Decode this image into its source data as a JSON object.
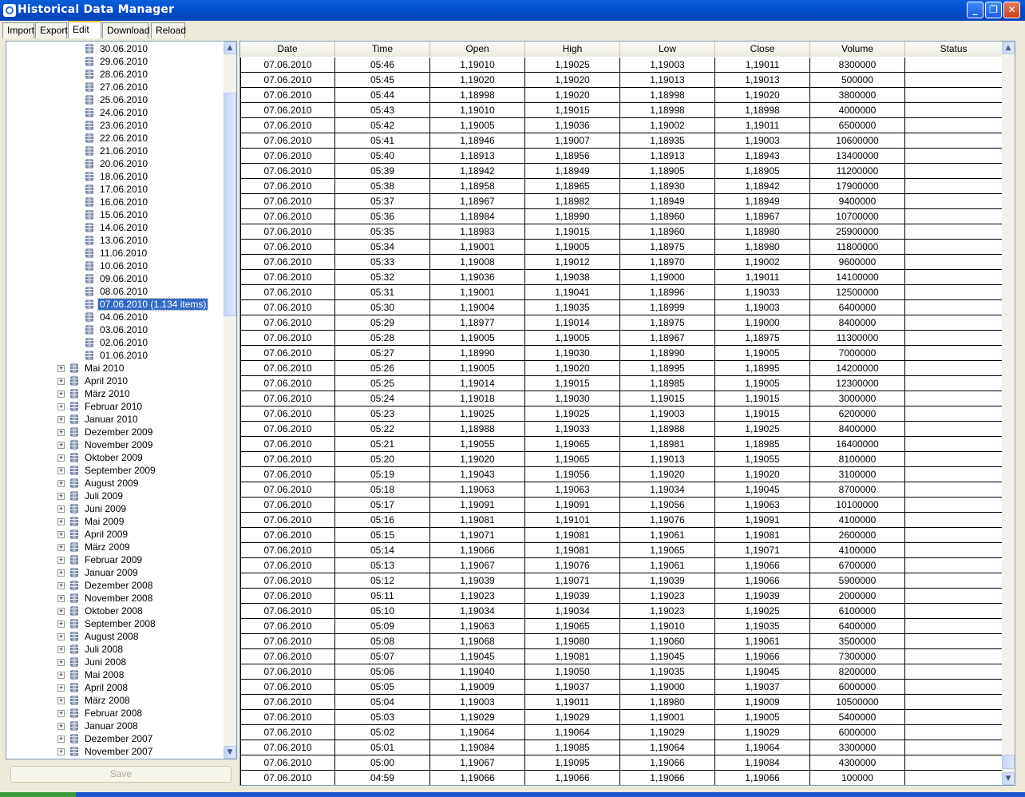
{
  "window": {
    "title": "Historical Data Manager",
    "buttons": {
      "minimize": "_",
      "maximize": "❐",
      "close": "✕"
    }
  },
  "tabs": [
    "Import",
    "Export",
    "Edit",
    "Download",
    "Reload"
  ],
  "active_tab": "Edit",
  "tree": {
    "days": [
      "30.06.2010",
      "29.06.2010",
      "28.06.2010",
      "27.06.2010",
      "25.06.2010",
      "24.06.2010",
      "23.06.2010",
      "22.06.2010",
      "21.06.2010",
      "20.06.2010",
      "18.06.2010",
      "17.06.2010",
      "16.06.2010",
      "15.06.2010",
      "14.06.2010",
      "13.06.2010",
      "11.06.2010",
      "10.06.2010",
      "09.06.2010",
      "08.06.2010",
      "07.06.2010 (1.134 items)",
      "04.06.2010",
      "03.06.2010",
      "02.06.2010",
      "01.06.2010"
    ],
    "selected_day": "07.06.2010 (1.134 items)",
    "months": [
      "Mai 2010",
      "April 2010",
      "März 2010",
      "Februar 2010",
      "Januar 2010",
      "Dezember 2009",
      "November 2009",
      "Oktober 2009",
      "September 2009",
      "August 2009",
      "Juli 2009",
      "Juni 2009",
      "Mai 2009",
      "April 2009",
      "März 2009",
      "Februar 2009",
      "Januar 2009",
      "Dezember 2008",
      "November 2008",
      "Oktober 2008",
      "September 2008",
      "August 2008",
      "Juli 2008",
      "Juni 2008",
      "Mai 2008",
      "April 2008",
      "März 2008",
      "Februar 2008",
      "Januar 2008",
      "Dezember 2007",
      "November 2007"
    ]
  },
  "save_label": "Save",
  "grid": {
    "columns": [
      "Date",
      "Time",
      "Open",
      "High",
      "Low",
      "Close",
      "Volume",
      "Status"
    ],
    "rows": [
      [
        "07.06.2010",
        "05:46",
        "1,19010",
        "1,19025",
        "1,19003",
        "1,19011",
        "8300000",
        ""
      ],
      [
        "07.06.2010",
        "05:45",
        "1,19020",
        "1,19020",
        "1,19013",
        "1,19013",
        "500000",
        ""
      ],
      [
        "07.06.2010",
        "05:44",
        "1,18998",
        "1,19020",
        "1,18998",
        "1,19020",
        "3800000",
        ""
      ],
      [
        "07.06.2010",
        "05:43",
        "1,19010",
        "1,19015",
        "1,18998",
        "1,18998",
        "4000000",
        ""
      ],
      [
        "07.06.2010",
        "05:42",
        "1,19005",
        "1,19036",
        "1,19002",
        "1,19011",
        "6500000",
        ""
      ],
      [
        "07.06.2010",
        "05:41",
        "1,18946",
        "1,19007",
        "1,18935",
        "1,19003",
        "10600000",
        ""
      ],
      [
        "07.06.2010",
        "05:40",
        "1,18913",
        "1,18956",
        "1,18913",
        "1,18943",
        "13400000",
        ""
      ],
      [
        "07.06.2010",
        "05:39",
        "1,18942",
        "1,18949",
        "1,18905",
        "1,18905",
        "11200000",
        ""
      ],
      [
        "07.06.2010",
        "05:38",
        "1,18958",
        "1,18965",
        "1,18930",
        "1,18942",
        "17900000",
        ""
      ],
      [
        "07.06.2010",
        "05:37",
        "1,18967",
        "1,18982",
        "1,18949",
        "1,18949",
        "9400000",
        ""
      ],
      [
        "07.06.2010",
        "05:36",
        "1,18984",
        "1,18990",
        "1,18960",
        "1,18967",
        "10700000",
        ""
      ],
      [
        "07.06.2010",
        "05:35",
        "1,18983",
        "1,19015",
        "1,18960",
        "1,18980",
        "25900000",
        ""
      ],
      [
        "07.06.2010",
        "05:34",
        "1,19001",
        "1,19005",
        "1,18975",
        "1,18980",
        "11800000",
        ""
      ],
      [
        "07.06.2010",
        "05:33",
        "1,19008",
        "1,19012",
        "1,18970",
        "1,19002",
        "9600000",
        ""
      ],
      [
        "07.06.2010",
        "05:32",
        "1,19036",
        "1,19038",
        "1,19000",
        "1,19011",
        "14100000",
        ""
      ],
      [
        "07.06.2010",
        "05:31",
        "1,19001",
        "1,19041",
        "1,18996",
        "1,19033",
        "12500000",
        ""
      ],
      [
        "07.06.2010",
        "05:30",
        "1,19004",
        "1,19035",
        "1,18999",
        "1,19003",
        "6400000",
        ""
      ],
      [
        "07.06.2010",
        "05:29",
        "1,18977",
        "1,19014",
        "1,18975",
        "1,19000",
        "8400000",
        ""
      ],
      [
        "07.06.2010",
        "05:28",
        "1,19005",
        "1,19005",
        "1,18967",
        "1,18975",
        "11300000",
        ""
      ],
      [
        "07.06.2010",
        "05:27",
        "1,18990",
        "1,19030",
        "1,18990",
        "1,19005",
        "7000000",
        ""
      ],
      [
        "07.06.2010",
        "05:26",
        "1,19005",
        "1,19020",
        "1,18995",
        "1,18995",
        "14200000",
        ""
      ],
      [
        "07.06.2010",
        "05:25",
        "1,19014",
        "1,19015",
        "1,18985",
        "1,19005",
        "12300000",
        ""
      ],
      [
        "07.06.2010",
        "05:24",
        "1,19018",
        "1,19030",
        "1,19015",
        "1,19015",
        "3000000",
        ""
      ],
      [
        "07.06.2010",
        "05:23",
        "1,19025",
        "1,19025",
        "1,19003",
        "1,19015",
        "6200000",
        ""
      ],
      [
        "07.06.2010",
        "05:22",
        "1,18988",
        "1,19033",
        "1,18988",
        "1,19025",
        "8400000",
        ""
      ],
      [
        "07.06.2010",
        "05:21",
        "1,19055",
        "1,19065",
        "1,18981",
        "1,18985",
        "16400000",
        ""
      ],
      [
        "07.06.2010",
        "05:20",
        "1,19020",
        "1,19065",
        "1,19013",
        "1,19055",
        "8100000",
        ""
      ],
      [
        "07.06.2010",
        "05:19",
        "1,19043",
        "1,19056",
        "1,19020",
        "1,19020",
        "3100000",
        ""
      ],
      [
        "07.06.2010",
        "05:18",
        "1,19063",
        "1,19063",
        "1,19034",
        "1,19045",
        "8700000",
        ""
      ],
      [
        "07.06.2010",
        "05:17",
        "1,19091",
        "1,19091",
        "1,19056",
        "1,19063",
        "10100000",
        ""
      ],
      [
        "07.06.2010",
        "05:16",
        "1,19081",
        "1,19101",
        "1,19076",
        "1,19091",
        "4100000",
        ""
      ],
      [
        "07.06.2010",
        "05:15",
        "1,19071",
        "1,19081",
        "1,19061",
        "1,19081",
        "2600000",
        ""
      ],
      [
        "07.06.2010",
        "05:14",
        "1,19066",
        "1,19081",
        "1,19065",
        "1,19071",
        "4100000",
        ""
      ],
      [
        "07.06.2010",
        "05:13",
        "1,19067",
        "1,19076",
        "1,19061",
        "1,19066",
        "6700000",
        ""
      ],
      [
        "07.06.2010",
        "05:12",
        "1,19039",
        "1,19071",
        "1,19039",
        "1,19066",
        "5900000",
        ""
      ],
      [
        "07.06.2010",
        "05:11",
        "1,19023",
        "1,19039",
        "1,19023",
        "1,19039",
        "2000000",
        ""
      ],
      [
        "07.06.2010",
        "05:10",
        "1,19034",
        "1,19034",
        "1,19023",
        "1,19025",
        "6100000",
        ""
      ],
      [
        "07.06.2010",
        "05:09",
        "1,19063",
        "1,19065",
        "1,19010",
        "1,19035",
        "6400000",
        ""
      ],
      [
        "07.06.2010",
        "05:08",
        "1,19068",
        "1,19080",
        "1,19060",
        "1,19061",
        "3500000",
        ""
      ],
      [
        "07.06.2010",
        "05:07",
        "1,19045",
        "1,19081",
        "1,19045",
        "1,19066",
        "7300000",
        ""
      ],
      [
        "07.06.2010",
        "05:06",
        "1,19040",
        "1,19050",
        "1,19035",
        "1,19045",
        "8200000",
        ""
      ],
      [
        "07.06.2010",
        "05:05",
        "1,19009",
        "1,19037",
        "1,19000",
        "1,19037",
        "6000000",
        ""
      ],
      [
        "07.06.2010",
        "05:04",
        "1,19003",
        "1,19011",
        "1,18980",
        "1,19009",
        "10500000",
        ""
      ],
      [
        "07.06.2010",
        "05:03",
        "1,19029",
        "1,19029",
        "1,19001",
        "1,19005",
        "5400000",
        ""
      ],
      [
        "07.06.2010",
        "05:02",
        "1,19064",
        "1,19064",
        "1,19029",
        "1,19029",
        "6000000",
        ""
      ],
      [
        "07.06.2010",
        "05:01",
        "1,19084",
        "1,19085",
        "1,19064",
        "1,19064",
        "3300000",
        ""
      ],
      [
        "07.06.2010",
        "05:00",
        "1,19067",
        "1,19095",
        "1,19066",
        "1,19084",
        "4300000",
        ""
      ],
      [
        "07.06.2010",
        "04:59",
        "1,19066",
        "1,19066",
        "1,19066",
        "1,19066",
        "100000",
        ""
      ]
    ]
  }
}
